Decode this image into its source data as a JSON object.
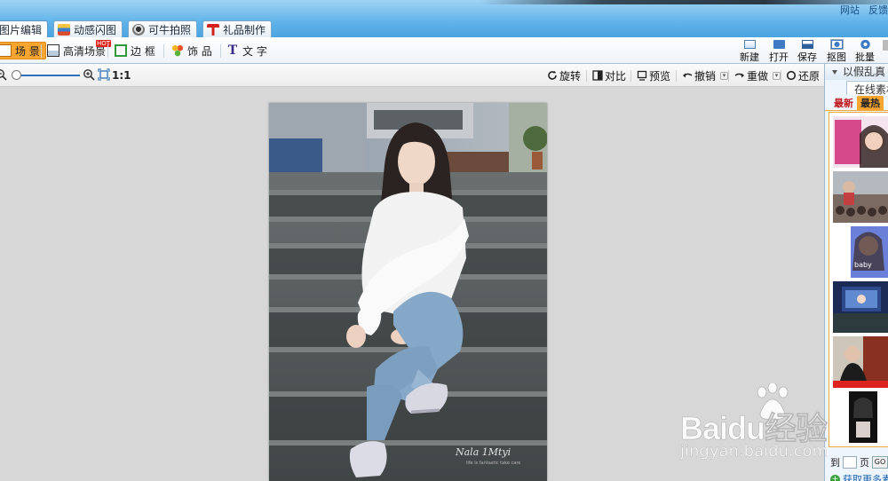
{
  "window": {
    "top_links": [
      "网站",
      "反馈"
    ]
  },
  "tabs": [
    {
      "label": "图片编辑",
      "icon": "photo-edit-icon",
      "active": true
    },
    {
      "label": "动感闪图",
      "icon": "flash-gif-icon",
      "active": false
    },
    {
      "label": "可牛拍照",
      "icon": "webcam-icon",
      "active": false
    },
    {
      "label": "礼品制作",
      "icon": "gift-icon",
      "active": false
    }
  ],
  "toolbar": {
    "scene_label": "场 景",
    "hd_scene_label": "高清场景",
    "hd_badge": "HOT",
    "frame_label": "边 框",
    "decor_label": "饰 品",
    "text_label": "文 字",
    "new_label": "新建",
    "open_label": "打开",
    "save_label": "保存",
    "capture_label": "抠图",
    "batch_label": "批量"
  },
  "controls": {
    "zoom_ratio": "1:1",
    "zoom_level": 0.05,
    "rotate_label": "旋转",
    "compare_label": "对比",
    "preview_label": "预览",
    "undo_label": "撤销",
    "redo_label": "重做",
    "restore_label": "还原"
  },
  "photo": {
    "signature": "Nala 1Mtyi",
    "signature_sub": "life is fantastic take care"
  },
  "right_panel": {
    "header": "以假乱真",
    "online_tab": "在线素材",
    "tab_newest": "最新",
    "tab_hottest": "最热",
    "page_prefix": "到",
    "page_suffix": "页",
    "go_label": "GO",
    "more_label": "获取更多素材"
  },
  "watermark": {
    "brand": "Baidu经验",
    "url": "jingyan.baidu.com"
  },
  "colors": {
    "accent_orange": "#f7a531",
    "title_blue": "#64b5ea",
    "hot_red": "#e0241b"
  }
}
